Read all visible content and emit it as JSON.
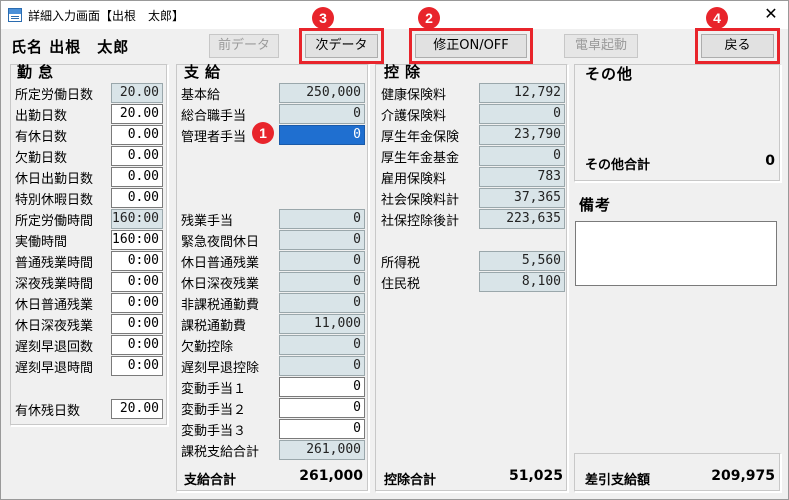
{
  "window": {
    "title": "詳細入力画面【出根　太郎】"
  },
  "employee": {
    "name_label": "氏名 出根　太郎"
  },
  "toolbar": {
    "prev": "前データ",
    "next": "次データ",
    "modify": "修正ON/OFF",
    "calc": "電卓起動",
    "back": "戻る"
  },
  "badges": [
    "1",
    "2",
    "3",
    "4"
  ],
  "colors": {
    "highlight": "#e8242b",
    "selected_field": "#1f6fd0",
    "readonly_field": "#d9e4e8"
  },
  "attendance": {
    "title": "勤怠",
    "rows": [
      {
        "label": "所定労働日数",
        "value": "20.00",
        "readonly": true
      },
      {
        "label": "出勤日数",
        "value": "20.00",
        "readonly": false
      },
      {
        "label": "有休日数",
        "value": "0.00",
        "readonly": false
      },
      {
        "label": "欠勤日数",
        "value": "0.00",
        "readonly": false
      },
      {
        "label": "休日出勤日数",
        "value": "0.00",
        "readonly": false
      },
      {
        "label": "特別休暇日数",
        "value": "0.00",
        "readonly": false
      },
      {
        "label": "所定労働時間",
        "value": "160:00",
        "readonly": true
      },
      {
        "label": "実働時間",
        "value": "160:00",
        "readonly": false
      },
      {
        "label": "普通残業時間",
        "value": "0:00",
        "readonly": false
      },
      {
        "label": "深夜残業時間",
        "value": "0:00",
        "readonly": false
      },
      {
        "label": "休日普通残業",
        "value": "0:00",
        "readonly": false
      },
      {
        "label": "休日深夜残業",
        "value": "0:00",
        "readonly": false
      },
      {
        "label": "遅刻早退回数",
        "value": "0:00",
        "readonly": false
      },
      {
        "label": "遅刻早退時間",
        "value": "0:00",
        "readonly": false
      }
    ],
    "paid_leave_remaining": {
      "label": "有休残日数",
      "value": "20.00"
    }
  },
  "payments": {
    "title": "支給",
    "top_rows": [
      {
        "label": "基本給",
        "value": "250,000",
        "state": "ro"
      },
      {
        "label": "総合職手当",
        "value": "0",
        "state": "ro"
      },
      {
        "label": "管理者手当",
        "value": "0",
        "state": "sel"
      }
    ],
    "bottom_rows": [
      {
        "label": "残業手当",
        "value": "0",
        "state": "ro"
      },
      {
        "label": "緊急夜間休日",
        "value": "0",
        "state": "ro"
      },
      {
        "label": "休日普通残業",
        "value": "0",
        "state": "ro"
      },
      {
        "label": "休日深夜残業",
        "value": "0",
        "state": "ro"
      },
      {
        "label": "非課税通勤費",
        "value": "0",
        "state": "ro"
      },
      {
        "label": "課税通勤費",
        "value": "11,000",
        "state": "ro"
      },
      {
        "label": "欠勤控除",
        "value": "0",
        "state": "ro"
      },
      {
        "label": "遅刻早退控除",
        "value": "0",
        "state": "ro"
      },
      {
        "label": "変動手当１",
        "value": "0",
        "state": "edit"
      },
      {
        "label": "変動手当２",
        "value": "0",
        "state": "edit"
      },
      {
        "label": "変動手当３",
        "value": "0",
        "state": "edit"
      },
      {
        "label": "課税支給合計",
        "value": "261,000",
        "state": "ro"
      }
    ],
    "total_label": "支給合計",
    "total_value": "261,000"
  },
  "deductions": {
    "title": "控除",
    "rows": [
      {
        "label": "健康保険料",
        "value": "12,792"
      },
      {
        "label": "介護保険料",
        "value": "0"
      },
      {
        "label": "厚生年金保険",
        "value": "23,790"
      },
      {
        "label": "厚生年金基金",
        "value": "0"
      },
      {
        "label": "雇用保険料",
        "value": "783"
      },
      {
        "label": "社会保険料計",
        "value": "37,365"
      },
      {
        "label": "社保控除後計",
        "value": "223,635"
      }
    ],
    "tax_rows": [
      {
        "label": "所得税",
        "value": "5,560"
      },
      {
        "label": "住民税",
        "value": "8,100"
      }
    ],
    "total_label": "控除合計",
    "total_value": "51,025"
  },
  "other": {
    "title": "その他",
    "total_label": "その他合計",
    "total_value": "0"
  },
  "remarks": {
    "title": "備考",
    "value": ""
  },
  "net_pay": {
    "label": "差引支給額",
    "value": "209,975"
  }
}
